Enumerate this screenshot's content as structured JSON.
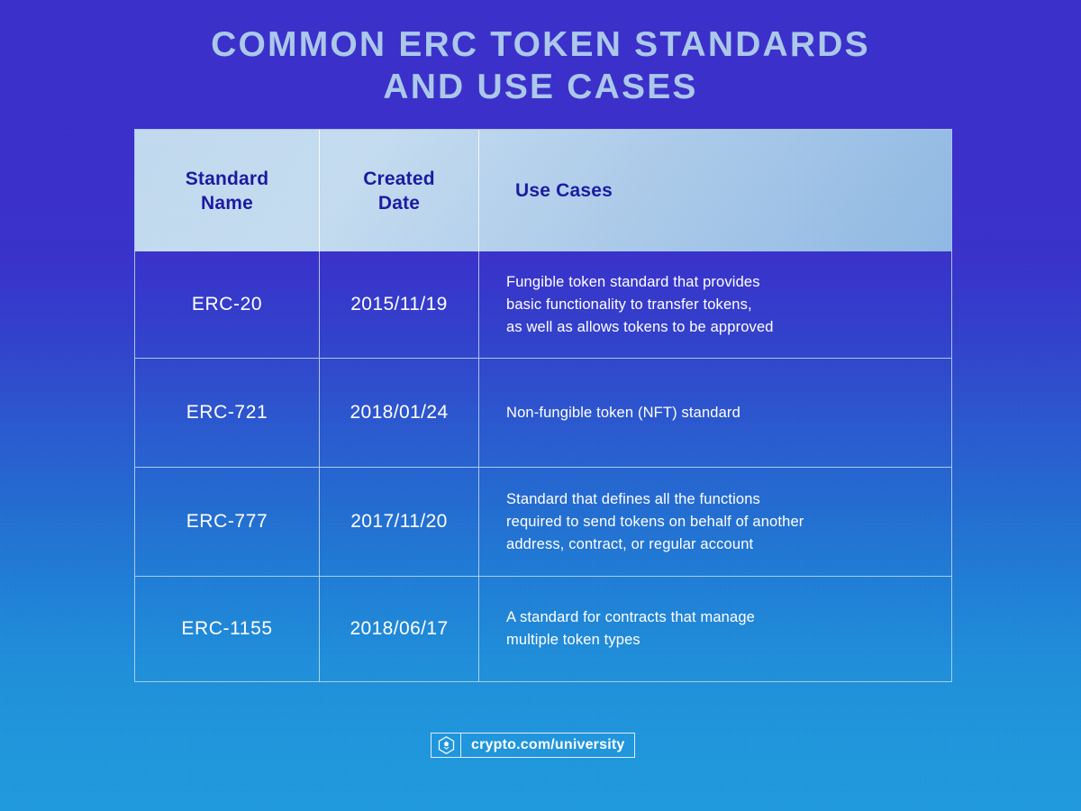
{
  "title": {
    "line1": "COMMON ERC TOKEN STANDARDS",
    "line2": "AND USE CASES"
  },
  "table": {
    "headers": {
      "standard_name_line1": "Standard",
      "standard_name_line2": "Name",
      "created_date_line1": "Created",
      "created_date_line2": "Date",
      "use_cases": "Use Cases"
    },
    "rows": [
      {
        "standard": "ERC-20",
        "date": "2015/11/19",
        "use_case_lines": [
          "Fungible token standard that provides",
          "basic functionality to transfer tokens,",
          "as well as allows tokens to be approved"
        ]
      },
      {
        "standard": "ERC-721",
        "date": "2018/01/24",
        "use_case_lines": [
          "Non-fungible token (NFT) standard"
        ]
      },
      {
        "standard": "ERC-777",
        "date": "2017/11/20",
        "use_case_lines": [
          "Standard that defines all the functions",
          "required to send tokens on behalf of another",
          "address, contract, or regular account"
        ]
      },
      {
        "standard": "ERC-1155",
        "date": "2018/06/17",
        "use_case_lines": [
          "A standard for contracts that manage",
          "multiple token types"
        ]
      }
    ]
  },
  "footer": {
    "logo_icon": "crypto-com-logo-icon",
    "url": "crypto.com/university"
  },
  "colors": {
    "background_top": "#3a2ec9",
    "background_bottom": "#2095dc",
    "title_text": "#a8c6e8",
    "header_fill_light": "#c2daef",
    "header_fill_dark": "#8cb6e2",
    "header_text": "#1a1a9e",
    "body_text": "#ffffff",
    "grid_line": "#cde1f8"
  }
}
